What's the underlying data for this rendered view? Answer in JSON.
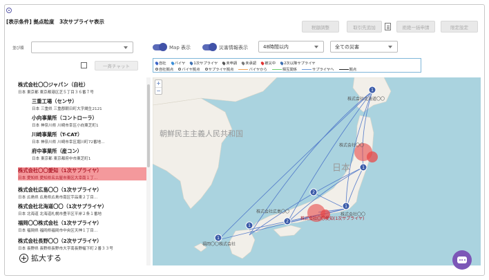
{
  "header": {
    "condition_text": "[表示条件] 拠点粒度　3次サプライヤ表示"
  },
  "toolbar": {
    "buttons": [
      "税額調整",
      "取引先追加",
      "拒絶一括申請",
      "限定設定"
    ]
  },
  "filters": {
    "select_label": "並び順",
    "select_value": "",
    "map_toggle_label": "Map 表示",
    "disaster_toggle_label": "災害情報表示",
    "time_value": "48時間以内",
    "disaster_value": "全ての災害",
    "group_chat_button": "一斉チャット"
  },
  "legend": {
    "row1": [
      {
        "label": "自社",
        "color": "#3b64c8",
        "icon": "pin-icon"
      },
      {
        "label": "バイヤ",
        "color": "#3b8ed8",
        "icon": "pin-icon"
      },
      {
        "label": "1次サプライヤ",
        "color": "#3d6fb0",
        "icon": "pin-icon"
      },
      {
        "label": "未申請",
        "color": "#555555",
        "icon": "pin-icon"
      },
      {
        "label": "未承認",
        "color": "#777777",
        "icon": "pin-icon"
      },
      {
        "label": "被災中",
        "color": "#e03030",
        "icon": "pin-icon"
      },
      {
        "label": "2次以降サプライヤ",
        "color": "#3d6fb0",
        "icon": "pin-icon"
      }
    ],
    "row2": [
      {
        "label": "自社拠点",
        "type": "circle"
      },
      {
        "label": "バイヤ拠点",
        "type": "circle"
      },
      {
        "label": "サプライヤ拠点",
        "type": "circle"
      },
      {
        "label": "バイヤから",
        "type": "line",
        "color": "#f0a050"
      },
      {
        "label": "相互関係",
        "type": "line",
        "color": "#6ad06a"
      },
      {
        "label": "サプライヤへ",
        "type": "line",
        "color": "#6a98d8"
      },
      {
        "label": "拠点",
        "type": "line",
        "color": "#222222"
      }
    ]
  },
  "companies": [
    {
      "name": "株式会社〇〇ジャパン（自社）",
      "addr": "日本 東京都 東京都港区芝５丁目３６番７号",
      "level": "main",
      "highlighted": false
    },
    {
      "name": "三重工場（センサ）",
      "addr": "日本 三重県 三重郡朝日町大字縄生2121",
      "level": "sub",
      "highlighted": false
    },
    {
      "name": "小向事業所（コントローラ）",
      "addr": "日本 神奈川県 川崎市幸区小向東芝町1",
      "level": "sub",
      "highlighted": false
    },
    {
      "name": "川崎事業所（T-CAT）",
      "addr": "日本 神奈川県 川崎市幸区堀川町72番地…",
      "level": "sub",
      "highlighted": false
    },
    {
      "name": "府中事業所（産コン）",
      "addr": "日本 東京都 東京都府中市東芝町1",
      "level": "sub",
      "highlighted": false
    },
    {
      "name": "株式会社〇〇愛知（1次サプライヤ）",
      "addr": "日本 愛知県 愛知県名古屋市東区大幸南１丁…",
      "level": "main",
      "highlighted": true
    },
    {
      "name": "株式会社広島〇〇（1次サプライヤ）",
      "addr": "日本 広島県 広島県広島市南区宇品東２丁目…",
      "level": "main",
      "highlighted": false
    },
    {
      "name": "株式会社北海道〇〇（1次サプライヤ）",
      "addr": "日本 北海道 北海道札幌市豊平区平岸２条１番地",
      "level": "main",
      "highlighted": false
    },
    {
      "name": "福岡〇〇株式会社（1次サプライヤ）",
      "addr": "日本 福岡県 福岡県福岡市中央区天神１丁目…",
      "level": "main",
      "highlighted": false
    },
    {
      "name": "株式会社長野〇〇（2次サプライヤ）",
      "addr": "日本 長野県 長野県長野市大字南長野幅下町２番３３号",
      "level": "main",
      "highlighted": false
    }
  ],
  "list_footer": {
    "zoom_label": "拡大する"
  },
  "map": {
    "labels": {
      "korea": "朝鮮民主主義人民共和国",
      "japan": "日本",
      "hokkaido_company": "株式会社北海道〇〇",
      "sendai_company": "株式会社〇〇",
      "kanto_company": "株式会社〇〇",
      "kyushu_company": "福岡〇〇株式会社",
      "hiroshima_company": "株式会社広島〇〇",
      "aichi_company": "株式会社〇〇愛知(1次サプライヤ)"
    },
    "zoom_in": "+",
    "zoom_out": "−",
    "markers": [
      "1",
      "2",
      "1",
      "2",
      "1",
      "1",
      "1"
    ]
  },
  "colors": {
    "accent": "#4152a8",
    "highlight_bg": "#f4999c",
    "highlight_text": "#b01d2b",
    "sea": "#aad3df",
    "land": "#f2efe9",
    "route": "#4a73c8",
    "disaster": "#e84a4a",
    "chat": "#7c57b7"
  }
}
